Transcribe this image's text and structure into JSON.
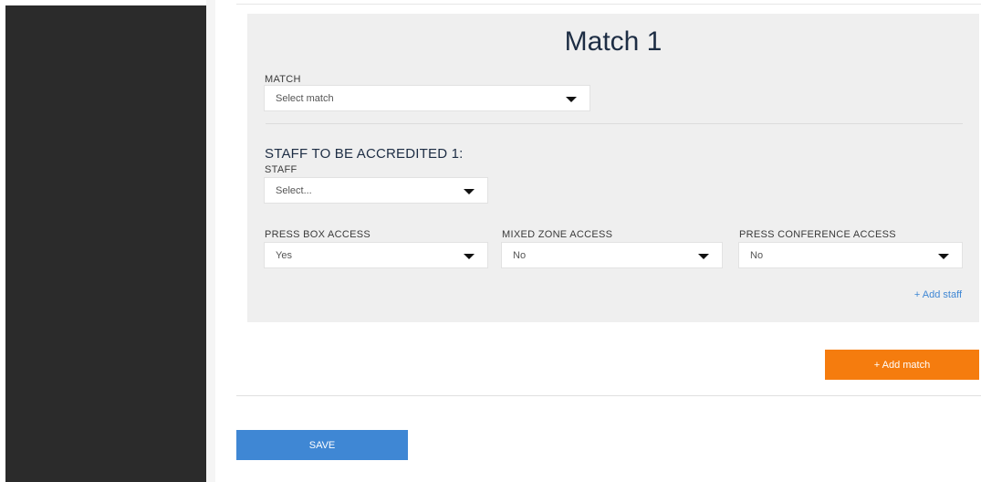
{
  "match_panel": {
    "title": "Match 1",
    "match_label": "MATCH",
    "match_select": "Select match",
    "staff_section_title": "STAFF TO BE ACCREDITED 1:",
    "staff_label": "STAFF",
    "staff_select": "Select...",
    "press_box_label": "PRESS BOX ACCESS",
    "press_box_value": "Yes",
    "mixed_zone_label": "MIXED ZONE ACCESS",
    "mixed_zone_value": "No",
    "press_conf_label": "PRESS CONFERENCE ACCESS",
    "press_conf_value": "No",
    "add_staff": "+ Add staff"
  },
  "actions": {
    "add_match": "+ Add match",
    "save": "SAVE"
  },
  "colors": {
    "sidebar": "#2b2b2b",
    "panel": "#efefef",
    "accent_orange": "#f57c0e",
    "accent_blue": "#3f87d4",
    "title": "#1d2d44"
  },
  "icons": {
    "dropdown": "caret-down-icon"
  }
}
